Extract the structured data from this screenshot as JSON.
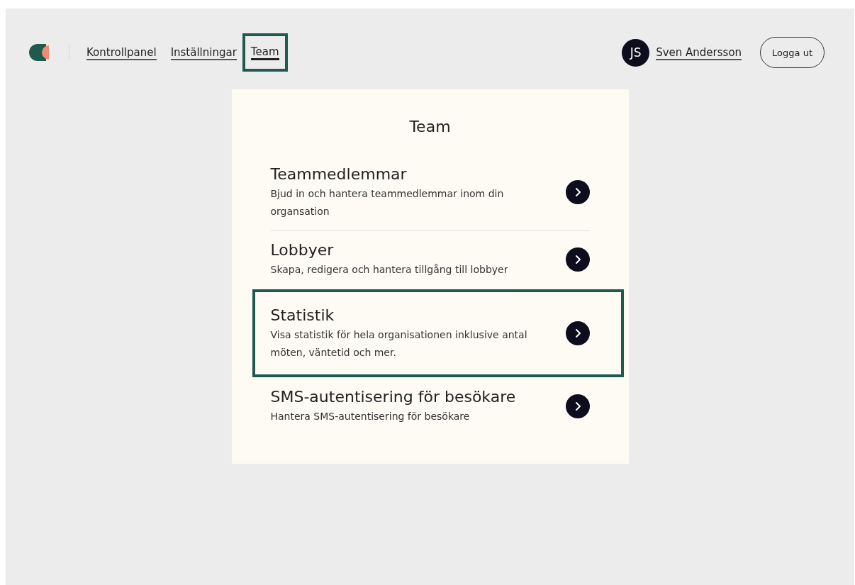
{
  "nav": {
    "items": [
      {
        "label": "Kontrollpanel",
        "selected": false,
        "highlighted": false
      },
      {
        "label": "Inställningar",
        "selected": false,
        "highlighted": false
      },
      {
        "label": "Team",
        "selected": true,
        "highlighted": true
      }
    ],
    "user": {
      "initials": "JS",
      "name": "Sven Andersson"
    },
    "logout": "Logga ut"
  },
  "card": {
    "title": "Team",
    "rows": [
      {
        "title": "Teammedlemmar",
        "description": "Bjud in och hantera teammedlemmar inom din organsation",
        "highlighted": false
      },
      {
        "title": "Lobbyer",
        "description": "Skapa, redigera och hantera tillgång till lobbyer",
        "highlighted": false
      },
      {
        "title": "Statistik",
        "description": "Visa statistik för hela organisationen inklusive antal möten, väntetid och mer.",
        "highlighted": true
      },
      {
        "title": "SMS-autentisering för besökare",
        "description": "Hantera SMS-autentisering för besökare",
        "highlighted": false
      }
    ]
  }
}
